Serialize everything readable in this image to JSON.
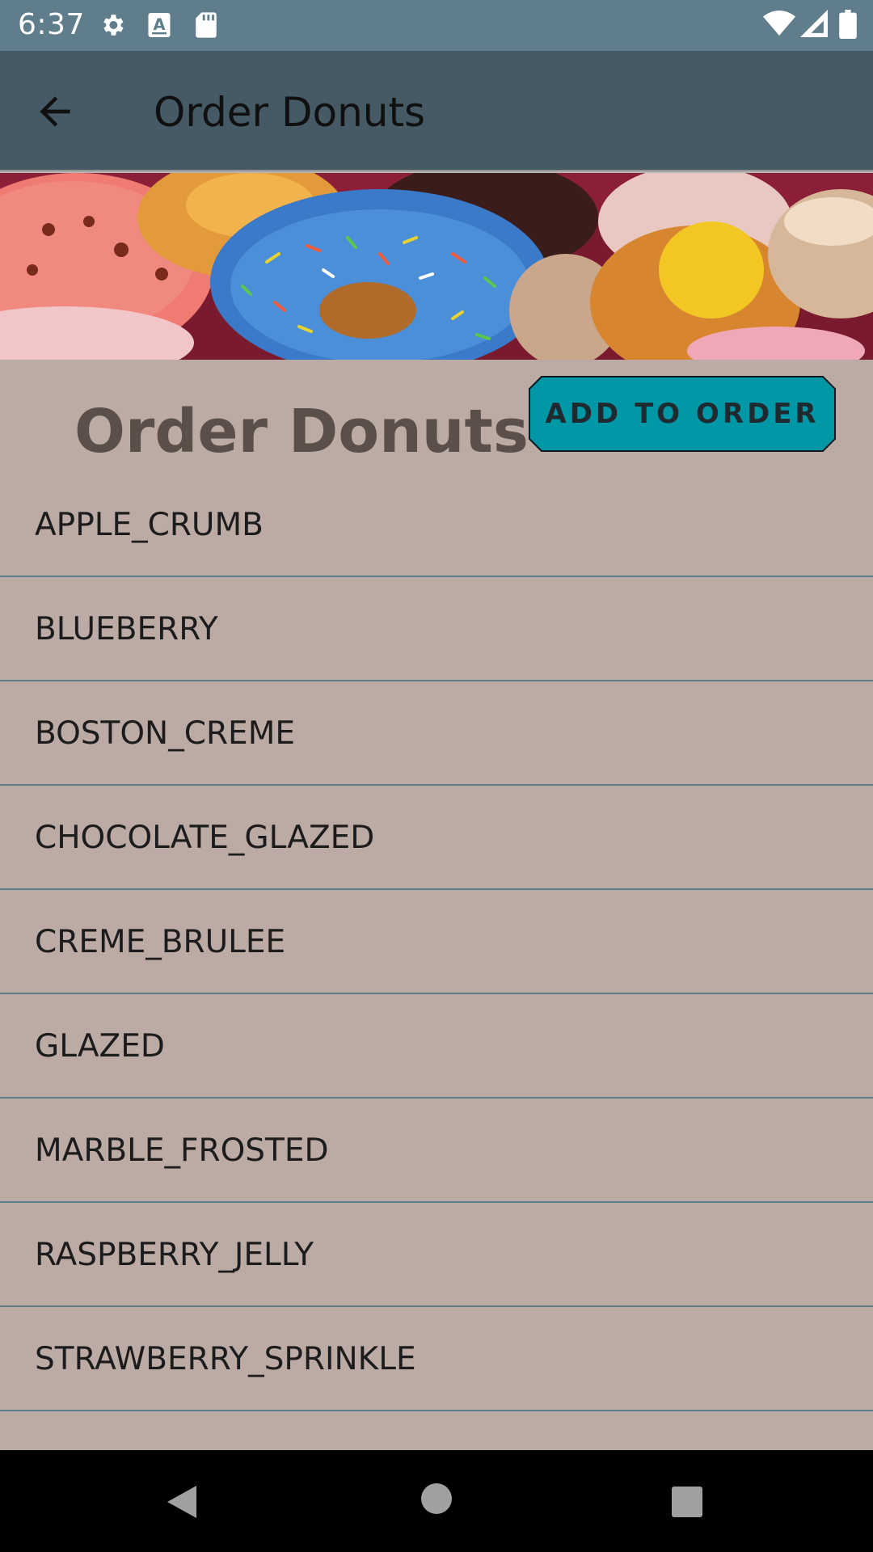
{
  "status_bar": {
    "time": "6:37",
    "icons": [
      "settings-gear-icon",
      "a-accessibility-icon",
      "sd-card-icon",
      "wifi-icon",
      "cell-signal-icon",
      "battery-icon"
    ]
  },
  "app_bar": {
    "title": "Order Donuts",
    "back_icon": "arrow-left-icon"
  },
  "banner": {
    "image": "donuts-banner-image"
  },
  "main": {
    "heading": "Order Donuts",
    "add_button_label": "ADD TO ORDER",
    "items": [
      {
        "label": "APPLE_CRUMB"
      },
      {
        "label": "BLUEBERRY"
      },
      {
        "label": "BOSTON_CREME"
      },
      {
        "label": "CHOCOLATE_GLAZED"
      },
      {
        "label": "CREME_BRULEE"
      },
      {
        "label": "GLAZED"
      },
      {
        "label": "MARBLE_FROSTED"
      },
      {
        "label": "RASPBERRY_JELLY"
      },
      {
        "label": "STRAWBERRY_SPRINKLE"
      }
    ]
  },
  "nav_bar": {
    "icons": [
      "back-triangle-icon",
      "home-circle-icon",
      "recents-square-icon"
    ]
  },
  "colors": {
    "status_bar": "#607d8b",
    "app_bar": "#455a64",
    "background": "#bcaaa4",
    "button": "#0097a7",
    "divider": "#607d8b"
  }
}
